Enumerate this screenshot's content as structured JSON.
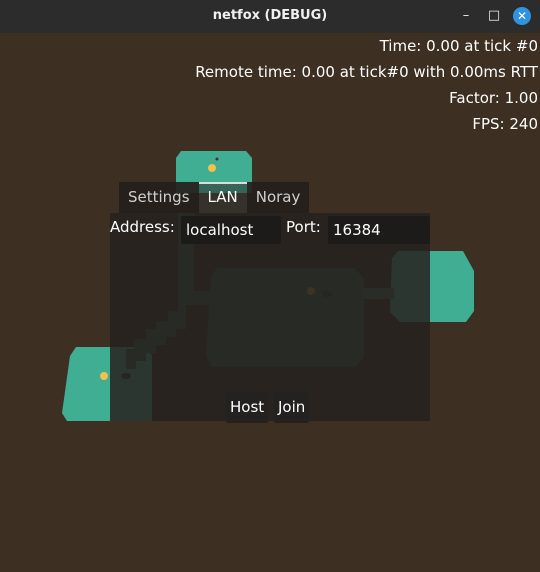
{
  "window": {
    "title": "netfox (DEBUG)",
    "min_glyph": "–",
    "max_glyph": "□",
    "close_glyph": "✕"
  },
  "debug": {
    "time": "Time: 0.00 at tick #0",
    "remote_time": "Remote time: 0.00 at tick#0 with 0.00ms RTT",
    "factor": "Factor: 1.00",
    "fps": "FPS: 240"
  },
  "menu": {
    "tabs": [
      {
        "label": "Settings",
        "active": false
      },
      {
        "label": "LAN",
        "active": true
      },
      {
        "label": "Noray",
        "active": false
      }
    ],
    "address_label": "Address:",
    "address_value": "localhost",
    "port_label": "Port:",
    "port_value": "16384",
    "host_button": "Host",
    "join_button": "Join"
  },
  "colors": {
    "background": "#3d3023",
    "floor_teal": "#3fae93",
    "floor_dark": "#2a5e50",
    "titlebar": "#2c2c2c",
    "close_accent": "#2f93e0"
  }
}
